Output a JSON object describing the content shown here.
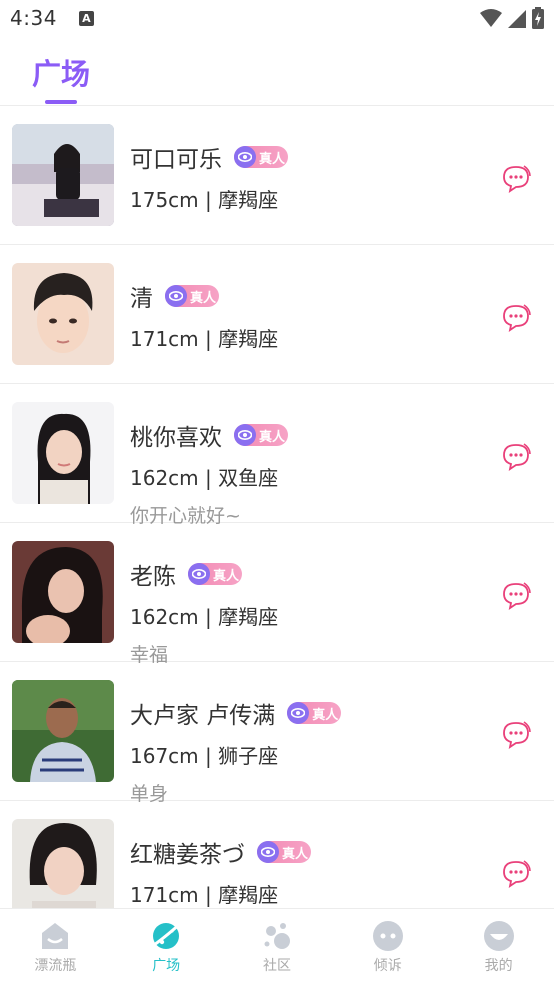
{
  "status": {
    "time": "4:34",
    "a_badge": "A"
  },
  "header": {
    "tab": "广场"
  },
  "users": [
    {
      "name": "可口可乐",
      "badge": "真人",
      "info": "175cm | 摩羯座",
      "bio": ""
    },
    {
      "name": "清",
      "badge": "真人",
      "info": "171cm | 摩羯座",
      "bio": ""
    },
    {
      "name": "桃你喜欢",
      "badge": "真人",
      "info": "162cm | 双鱼座",
      "bio": "你开心就好~"
    },
    {
      "name": "老陈",
      "badge": "真人",
      "info": "162cm | 摩羯座",
      "bio": "幸福"
    },
    {
      "name": "大卢家 卢传满",
      "badge": "真人",
      "info": "167cm | 狮子座",
      "bio": "单身"
    },
    {
      "name": "红糖姜茶づ",
      "badge": "真人",
      "info": "171cm | 摩羯座",
      "bio": ""
    }
  ],
  "nav": [
    {
      "label": "漂流瓶",
      "icon": "bottle-icon"
    },
    {
      "label": "广场",
      "icon": "planet-icon"
    },
    {
      "label": "社区",
      "icon": "bubbles-icon"
    },
    {
      "label": "倾诉",
      "icon": "chat-face-icon"
    },
    {
      "label": "我的",
      "icon": "smile-face-icon"
    }
  ],
  "colors": {
    "accent": "#8b5cf6",
    "badge_pink": "#f38ab3",
    "chat_pink": "#e9407a",
    "nav_active": "#25c0c8"
  }
}
